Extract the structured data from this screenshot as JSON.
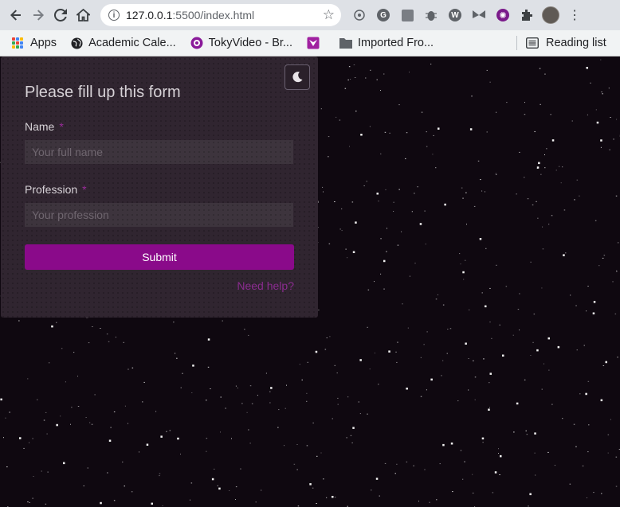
{
  "browser": {
    "url_host": "127.0.0.1",
    "url_rest": ":5500/index.html",
    "extensions": [
      "puzzle-icon",
      "grammarly-icon",
      "image-icon",
      "bug-icon",
      "wordpress-icon",
      "butterfly-icon",
      "sparkle-icon",
      "extensions-icon",
      "profile-avatar"
    ],
    "bookmarks": [
      {
        "label": "Apps",
        "icon": "apps-grid-icon"
      },
      {
        "label": "Academic Cale...",
        "icon": "globe-icon"
      },
      {
        "label": "TokyVideo - Br...",
        "icon": "tokyvideo-icon"
      },
      {
        "label": "",
        "icon": "fox-icon"
      },
      {
        "label": "Imported Fro...",
        "icon": "folder-icon"
      }
    ],
    "reading_list": "Reading list"
  },
  "form": {
    "title": "Please fill up this form",
    "name_label": "Name",
    "name_placeholder": "Your full name",
    "profession_label": "Profession",
    "profession_placeholder": "Your profession",
    "required_mark": "*",
    "submit_label": "Submit",
    "help_link": "Need help?",
    "theme_toggle_icon": "moon-icon"
  },
  "colors": {
    "page_background": "#0f0810",
    "panel_background": "#302530",
    "accent": "#8a0a8a",
    "link": "#8a2c8f"
  }
}
